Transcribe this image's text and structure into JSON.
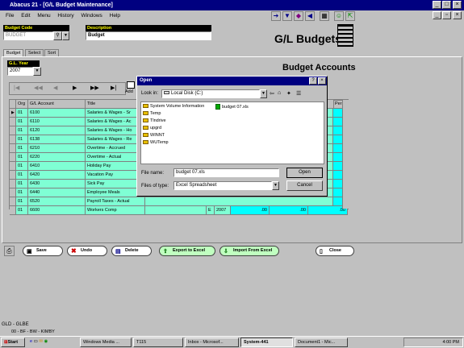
{
  "window": {
    "title": "Abacus 21 - [G/L Budget Maintenance]"
  },
  "menu": [
    "File",
    "Edit",
    "Menu",
    "History",
    "Windows",
    "Help"
  ],
  "header": {
    "budget_code_label": "Budget Code",
    "budget_code_value": "BUDGET",
    "description_label": "Description",
    "description_value": "Budget",
    "app_title": "G/L Budgets",
    "section_title": "Budget Accounts",
    "gl_year_label": "G.L. Year",
    "gl_year_value": "2007",
    "add_label": "Add"
  },
  "tabs": [
    "Budget",
    "Select",
    "Sort"
  ],
  "grid": {
    "columns": [
      "Org",
      "G/L Account",
      "Title"
    ],
    "right_column": "Per",
    "rows": [
      {
        "org": "01",
        "account": "6100",
        "title": "Salaries & Wages - Sr"
      },
      {
        "org": "01",
        "account": "6110",
        "title": "Salaries & Wages - Ac"
      },
      {
        "org": "01",
        "account": "6120",
        "title": "Salaries & Wages - Ho"
      },
      {
        "org": "01",
        "account": "6138",
        "title": "Salaries & Wages - Re"
      },
      {
        "org": "01",
        "account": "6210",
        "title": "Overtime - Accrued"
      },
      {
        "org": "01",
        "account": "6220",
        "title": "Overtime - Actual"
      },
      {
        "org": "01",
        "account": "6410",
        "title": "Holiday Pay"
      },
      {
        "org": "01",
        "account": "6420",
        "title": "Vacation Pay"
      },
      {
        "org": "01",
        "account": "6430",
        "title": "Sick Pay"
      },
      {
        "org": "01",
        "account": "6440",
        "title": "Employee Meals"
      },
      {
        "org": "01",
        "account": "6520",
        "title": "Payroll Taxes - Actual"
      },
      {
        "org": "01",
        "account": "6600",
        "title": "Workers Comp",
        "type": "E",
        "year": "2007",
        "v1": ".00",
        "v2": ".00",
        "v3": ".00"
      }
    ]
  },
  "dialog": {
    "title": "Open",
    "look_in_label": "Look in:",
    "look_in_value": "Local Disk (C:)",
    "folders": [
      "System Volume Information",
      "Temp",
      "Tlndrive",
      "upgrd",
      "WINNT",
      "WUTemp"
    ],
    "files": [
      "budget 07.xls"
    ],
    "file_name_label": "File name:",
    "file_name_value": "budget 07.xls",
    "file_type_label": "Files of type:",
    "file_type_value": "Excel Spreadsheet",
    "open_label": "Open",
    "cancel_label": "Cancel"
  },
  "buttons": {
    "save": "Save",
    "undo": "Undo",
    "delete": "Delete",
    "export": "Export to Excel",
    "import": "Import From Excel",
    "close": "Close"
  },
  "status": {
    "line1": "GLD - GLBE",
    "line2": "00 - BF - BW - KIMBY"
  },
  "taskbar": {
    "start": "Start",
    "tasks": [
      "Windows Media ...",
      "T115",
      "Inbox - Microsof...",
      "System-441",
      "Document1 - Mic..."
    ],
    "clock": "4:00 PM"
  }
}
